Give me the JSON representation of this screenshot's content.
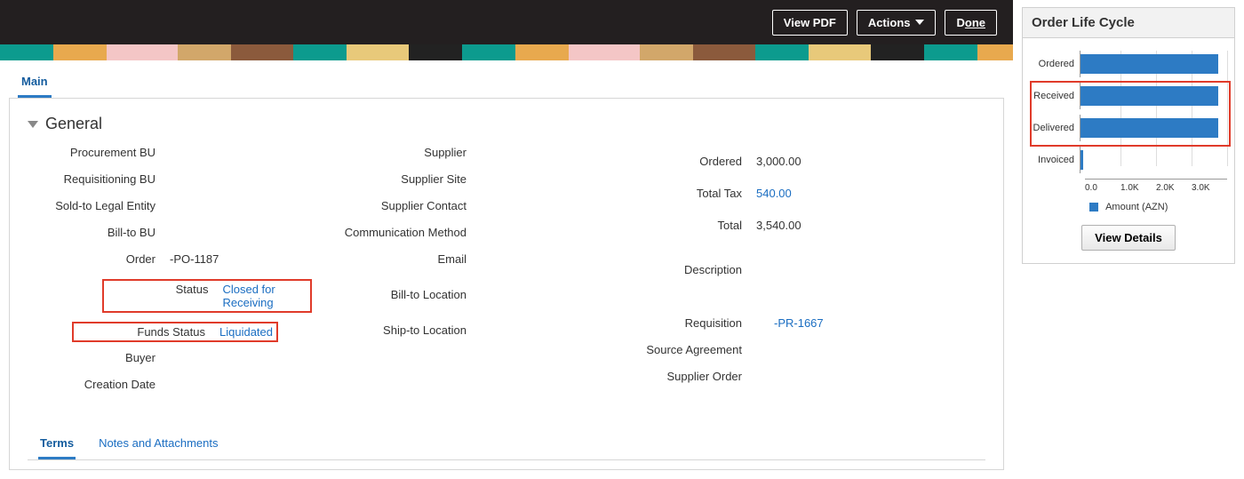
{
  "header": {
    "view_pdf": "View PDF",
    "actions": "Actions",
    "done_prefix": "D",
    "done_suffix": "one"
  },
  "tabs": {
    "main": "Main"
  },
  "section": {
    "title": "General"
  },
  "col1": {
    "procurement_bu": {
      "label": "Procurement BU",
      "value": ""
    },
    "requisitioning_bu": {
      "label": "Requisitioning BU",
      "value": ""
    },
    "sold_to": {
      "label": "Sold-to Legal Entity",
      "value": ""
    },
    "bill_to_bu": {
      "label": "Bill-to BU",
      "value": ""
    },
    "order": {
      "label": "Order",
      "value": "-PO-1187"
    },
    "status": {
      "label": "Status",
      "value": "Closed for Receiving"
    },
    "funds_status": {
      "label": "Funds Status",
      "value": "Liquidated"
    },
    "buyer": {
      "label": "Buyer",
      "value": ""
    },
    "creation_date": {
      "label": "Creation Date",
      "value": ""
    }
  },
  "col2": {
    "supplier": {
      "label": "Supplier",
      "value": ""
    },
    "supplier_site": {
      "label": "Supplier Site",
      "value": ""
    },
    "supplier_contact": {
      "label": "Supplier Contact",
      "value": ""
    },
    "comm_method": {
      "label": "Communication Method",
      "value": ""
    },
    "email": {
      "label": "Email",
      "value": ""
    },
    "bill_to_loc": {
      "label": "Bill-to Location",
      "value": ""
    },
    "ship_to_loc": {
      "label": "Ship-to Location",
      "value": ""
    }
  },
  "col3": {
    "ordered": {
      "label": "Ordered",
      "value": "3,000.00"
    },
    "total_tax": {
      "label": "Total Tax",
      "value": "540.00"
    },
    "total": {
      "label": "Total",
      "value": "3,540.00"
    },
    "description": {
      "label": "Description",
      "value": ""
    },
    "requisition": {
      "label": "Requisition",
      "value": "-PR-1667"
    },
    "source_agreement": {
      "label": "Source Agreement",
      "value": ""
    },
    "supplier_order": {
      "label": "Supplier Order",
      "value": ""
    }
  },
  "sub_tabs": {
    "terms": "Terms",
    "notes": "Notes and Attachments"
  },
  "olc": {
    "title": "Order Life Cycle",
    "legend": "Amount (AZN)",
    "view_details": "View Details",
    "x_ticks": [
      "0.0",
      "1.0K",
      "2.0K",
      "3.0K"
    ]
  },
  "chart_data": {
    "type": "bar",
    "orientation": "horizontal",
    "categories": [
      "Ordered",
      "Received",
      "Delivered",
      "Invoiced"
    ],
    "values": [
      3000,
      3000,
      3000,
      50
    ],
    "xlabel": "",
    "ylabel": "",
    "xlim": [
      0,
      3200
    ],
    "title": "Order Life Cycle",
    "series_name": "Amount (AZN)"
  }
}
